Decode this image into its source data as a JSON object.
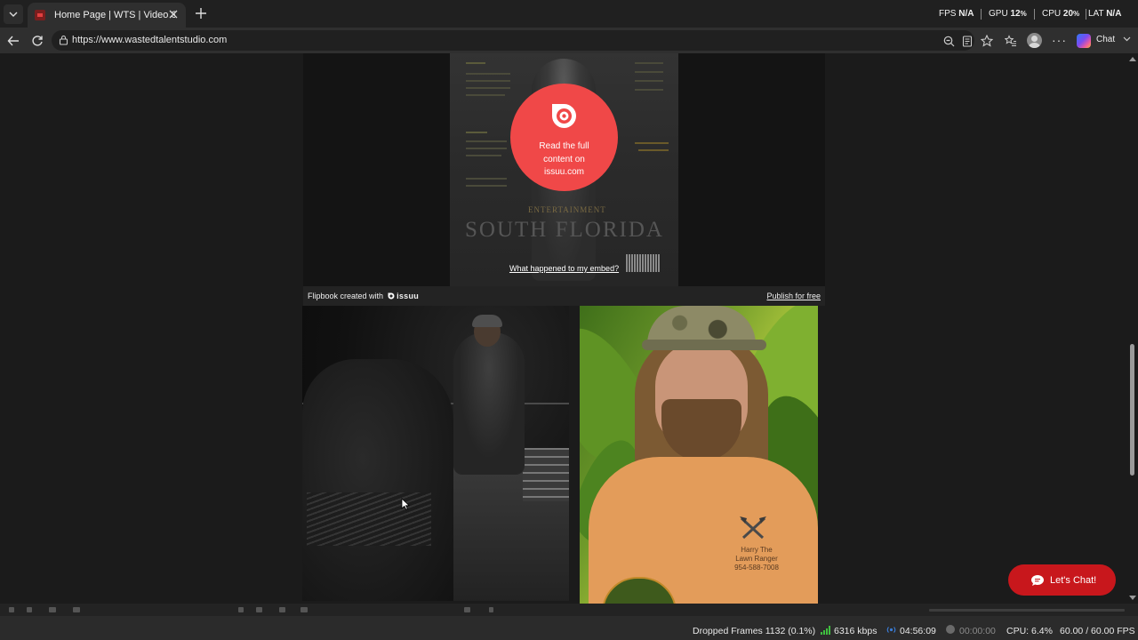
{
  "browser": {
    "tab": {
      "title": "Home Page | WTS | Video Services"
    },
    "url": "https://www.wastedtalentstudio.com",
    "copilot_label": "Chat"
  },
  "perf_overlay": {
    "fps_label": "FPS",
    "fps_value": "N/A",
    "gpu_label": "GPU",
    "gpu_value": "12",
    "cpu_label": "CPU",
    "cpu_value": "20",
    "percent": "%",
    "lat_label": "LAT",
    "lat_value": "N/A"
  },
  "embed": {
    "read_text": "Read the full content on issuu.com",
    "embed_link": "What happened to my embed?",
    "flipbook_text": "Flipbook created with",
    "issuu_brand": "issuu",
    "publish_link": "Publish for free",
    "cover_ent": "ENTERTAINMENT",
    "cover_title": "SOUTH FLORIDA"
  },
  "chat_widget": {
    "label": "Let's Chat!"
  },
  "shirt_logo_text": "Harry The\nLawn Ranger\n954-588-7008",
  "status": {
    "dropped_frames": "Dropped Frames 1132 (0.1%)",
    "bitrate": "6316 kbps",
    "stream_time": "04:56:09",
    "rec_time": "00:00:00",
    "cpu": "CPU: 6.4%",
    "fps": "60.00 / 60.00 FPS"
  },
  "colors": {
    "chat_button": "#c8171c",
    "issuu_red": "#f04848",
    "bitrate_green": "#3fbf3f",
    "stream_blue": "#3a7bd5"
  },
  "icons": [
    "tab-list-icon",
    "close-icon",
    "plus-icon",
    "back-arrow-icon",
    "reload-icon",
    "lock-icon",
    "zoom-icon",
    "reader-icon",
    "star-icon",
    "favorites-icon",
    "profile-icon",
    "more-icon",
    "copilot-icon",
    "chevron-down-icon",
    "issuu-logo-icon",
    "chat-bubble-icon",
    "signal-icon",
    "broadcast-icon",
    "record-dot-icon"
  ]
}
